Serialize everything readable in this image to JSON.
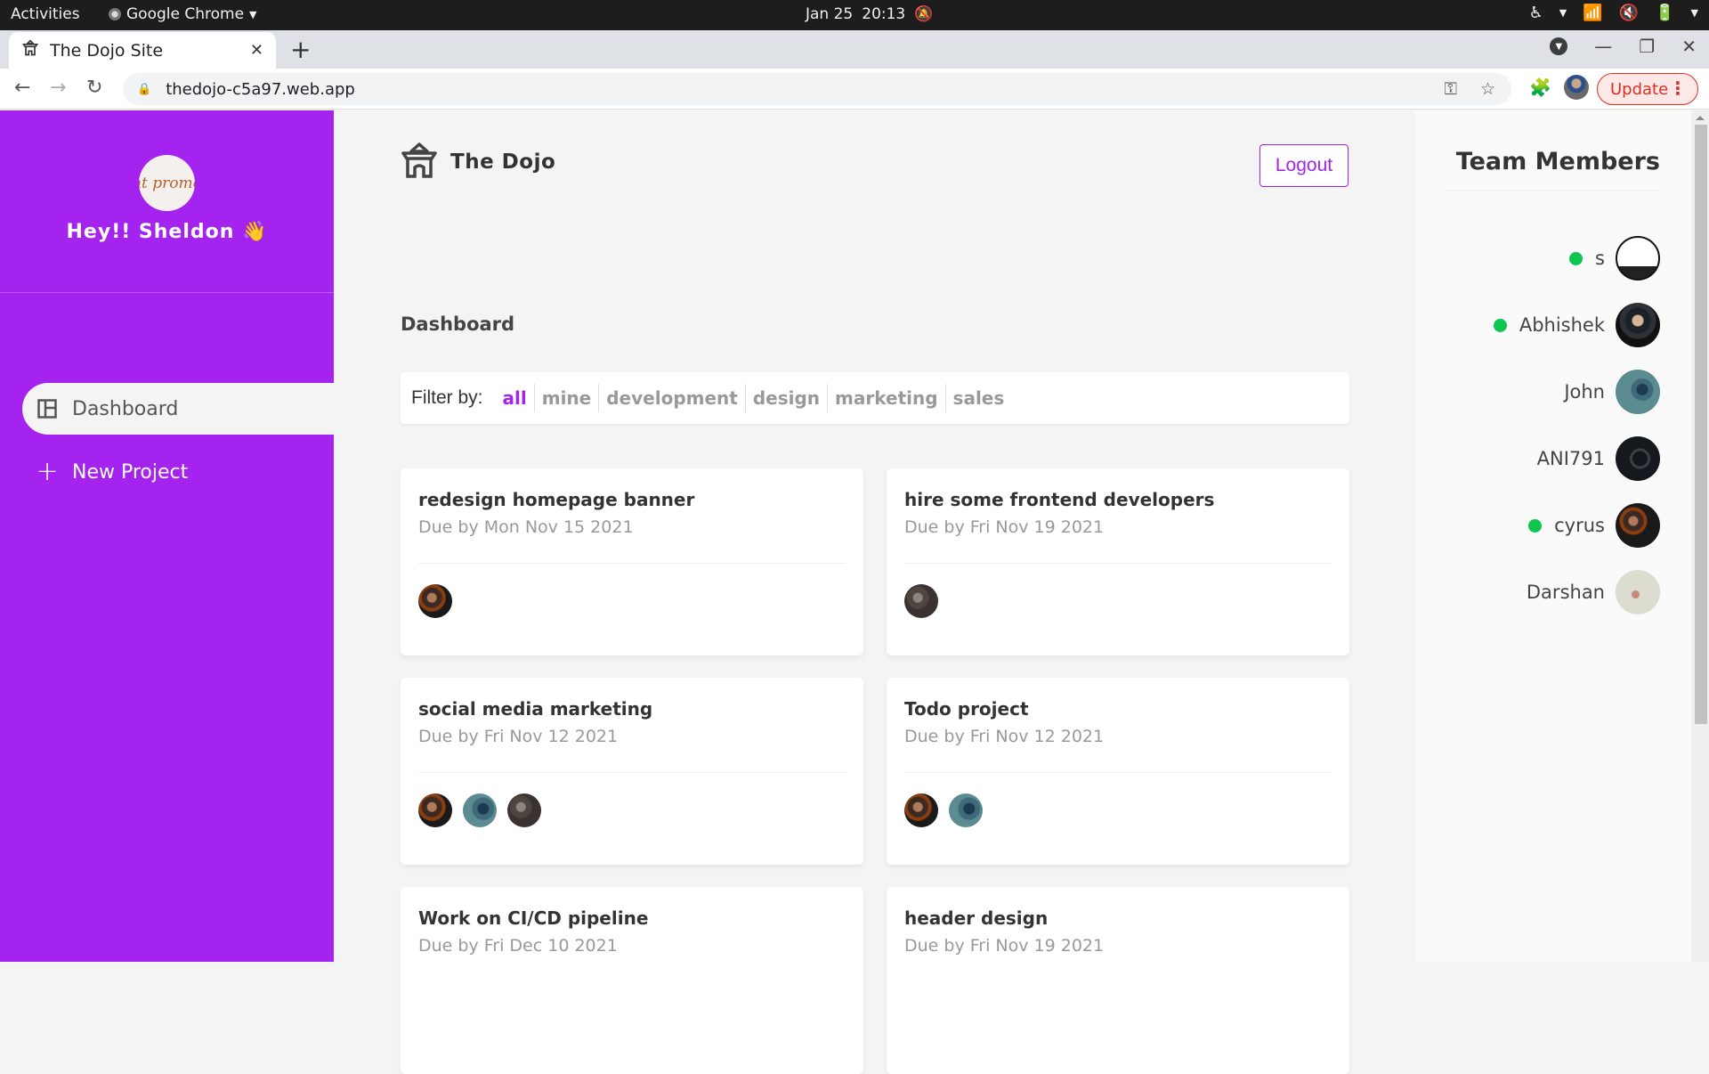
{
  "os_bar": {
    "activities": "Activities",
    "app_name": "Google Chrome",
    "date": "Jan 25",
    "time": "20:13"
  },
  "browser": {
    "tab_title": "The Dojo Site",
    "url": "thedojo-c5a97.web.app",
    "update_label": "Update"
  },
  "sidebar": {
    "greeting": "Hey!! Sheldon 👋",
    "avatar_text": "nt promo",
    "items": [
      {
        "label": "Dashboard",
        "icon": "dashboard-icon",
        "active": true
      },
      {
        "label": "New Project",
        "icon": "plus-icon",
        "active": false
      }
    ]
  },
  "header": {
    "brand": "The Dojo",
    "logout_label": "Logout"
  },
  "main": {
    "page_title": "Dashboard",
    "filter": {
      "label": "Filter by:",
      "options": [
        "all",
        "mine",
        "development",
        "design",
        "marketing",
        "sales"
      ],
      "active": "all"
    },
    "projects": [
      {
        "title": "redesign homepage banner",
        "due": "Due by Mon Nov 15 2021",
        "assignees": [
          "cyrus"
        ]
      },
      {
        "title": "hire some frontend developers",
        "due": "Due by Fri Nov 19 2021",
        "assignees": [
          "unknown"
        ]
      },
      {
        "title": "social media marketing",
        "due": "Due by Fri Nov 12 2021",
        "assignees": [
          "cyrus",
          "John",
          "unknown"
        ]
      },
      {
        "title": "Todo project",
        "due": "Due by Fri Nov 12 2021",
        "assignees": [
          "cyrus",
          "John"
        ]
      },
      {
        "title": "Work on CI/CD pipeline",
        "due": "Due by Fri Dec 10 2021",
        "assignees": []
      },
      {
        "title": "header design",
        "due": "Due by Fri Nov 19 2021",
        "assignees": []
      }
    ]
  },
  "team": {
    "title": "Team Members",
    "members": [
      {
        "name": "s",
        "online": true
      },
      {
        "name": "Abhishek",
        "online": true
      },
      {
        "name": "John",
        "online": false
      },
      {
        "name": "ANI791",
        "online": false
      },
      {
        "name": "cyrus",
        "online": true
      },
      {
        "name": "Darshan",
        "online": false
      }
    ]
  },
  "colors": {
    "accent": "#a423ee",
    "online": "#0ec64f",
    "background": "#f4f4f4"
  }
}
